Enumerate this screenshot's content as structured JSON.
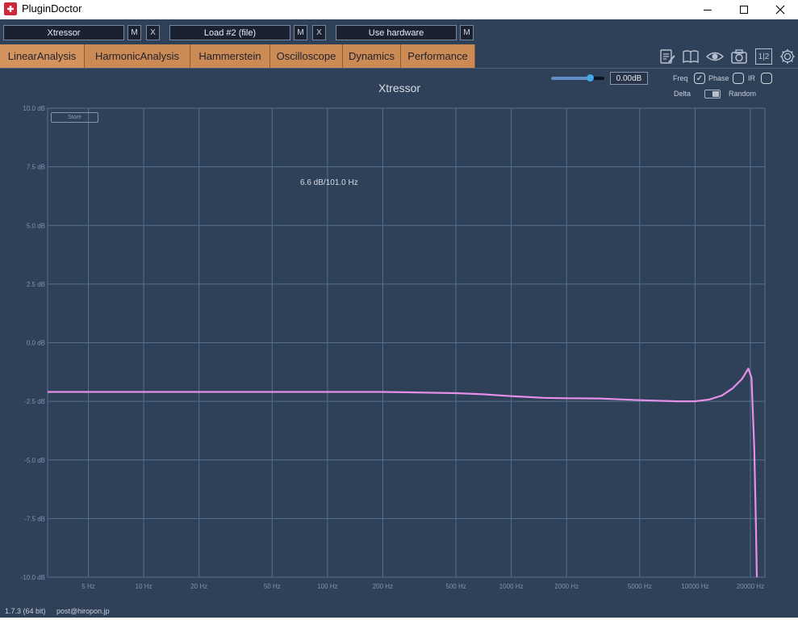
{
  "window": {
    "title": "PluginDoctor"
  },
  "slots": [
    {
      "label": "Xtressor",
      "buttons": [
        "M",
        "X"
      ]
    },
    {
      "label": "Load #2 (file)",
      "buttons": [
        "M",
        "X"
      ]
    },
    {
      "label": "Use hardware",
      "buttons": [
        "M"
      ]
    }
  ],
  "tabs": [
    {
      "label": "LinearAnalysis",
      "active": true
    },
    {
      "label": "HarmonicAnalysis"
    },
    {
      "label": "Hammerstein"
    },
    {
      "label": "Oscilloscope"
    },
    {
      "label": "Dynamics"
    },
    {
      "label": "Performance"
    }
  ],
  "toolbar": {
    "icons": [
      "notes-icon",
      "manual-icon",
      "eye-icon",
      "camera-icon",
      "split-view-icon",
      "gear-icon"
    ],
    "split_label": "1|2"
  },
  "controls": {
    "gain_value": "0.00dB",
    "gain_level": 0.72,
    "freq_label": "Freq",
    "freq_checked": true,
    "phase_label": "Phase",
    "phase_checked": false,
    "ir_label": "IR",
    "ir_checked": false,
    "delta_label": "Delta",
    "random_label": "Random",
    "store_label": "Store"
  },
  "chart_data": {
    "type": "line",
    "title": "Xtressor",
    "x_scale": "log",
    "xlim": [
      3,
      24000
    ],
    "ylim": [
      -10,
      10
    ],
    "x_ticks": [
      5,
      10,
      20,
      50,
      100,
      200,
      500,
      1000,
      2000,
      5000,
      10000,
      20000
    ],
    "x_tick_labels": [
      "5 Hz",
      "10 Hz",
      "20 Hz",
      "50 Hz",
      "100 Hz",
      "200 Hz",
      "500 Hz",
      "1000 Hz",
      "2000 Hz",
      "5000 Hz",
      "10000 Hz",
      "20000 Hz"
    ],
    "y_ticks": [
      10,
      7.5,
      5,
      2.5,
      0,
      -2.5,
      -5,
      -7.5,
      -10
    ],
    "y_tick_labels": [
      "10.0 dB",
      "7.5 dB",
      "5.0 dB",
      "2.5 dB",
      "0.0 dB",
      "-2.5 dB",
      "-5.0 dB",
      "-7.5 dB",
      "-10.0 dB"
    ],
    "grid": true,
    "color": "#e58fe8",
    "readout": "6.6 dB/101.0 Hz",
    "series": [
      {
        "x": [
          3,
          10,
          50,
          100,
          200,
          300,
          500,
          700,
          1000,
          1500,
          2000,
          3000,
          5000,
          8000,
          10000,
          12000,
          14000,
          16000,
          18000,
          19500,
          20300,
          21000,
          21400,
          21700
        ],
        "y": [
          -2.1,
          -2.1,
          -2.1,
          -2.1,
          -2.1,
          -2.12,
          -2.15,
          -2.2,
          -2.28,
          -2.35,
          -2.37,
          -2.38,
          -2.45,
          -2.5,
          -2.5,
          -2.42,
          -2.25,
          -1.95,
          -1.55,
          -1.1,
          -1.5,
          -4.5,
          -7.5,
          -10
        ]
      }
    ]
  },
  "footer": {
    "version": "1.7.3 (64 bit)",
    "email": "post@hiropon.jp"
  }
}
